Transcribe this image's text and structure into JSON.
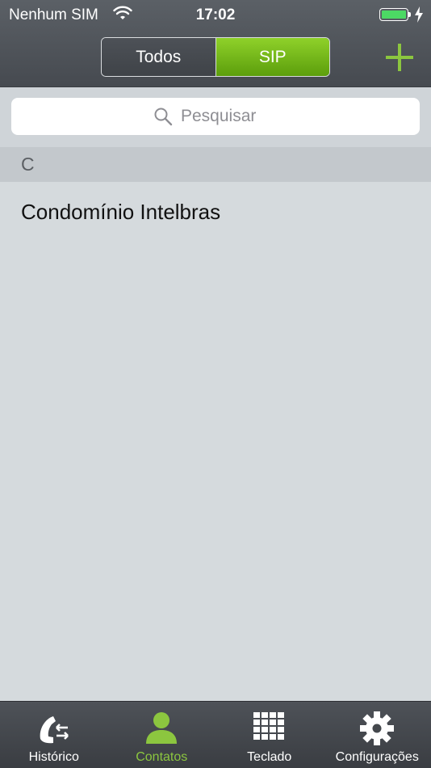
{
  "status_bar": {
    "carrier": "Nenhum SIM",
    "time": "17:02"
  },
  "header": {
    "segments": [
      {
        "label": "Todos",
        "selected": false
      },
      {
        "label": "SIP",
        "selected": true
      }
    ],
    "add_icon": "plus-icon"
  },
  "search": {
    "placeholder": "Pesquisar",
    "value": "",
    "icon": "search-icon"
  },
  "contacts": {
    "sections": [
      {
        "letter": "C",
        "items": [
          "Condomínio Intelbras"
        ]
      }
    ]
  },
  "tabbar": {
    "items": [
      {
        "label": "Histórico",
        "icon": "phone-history-icon",
        "active": false
      },
      {
        "label": "Contatos",
        "icon": "person-icon",
        "active": true
      },
      {
        "label": "Teclado",
        "icon": "keypad-icon",
        "active": false
      },
      {
        "label": "Configurações",
        "icon": "gear-icon",
        "active": false
      }
    ]
  },
  "colors": {
    "accent_green": "#8cc63f",
    "bar_dark": "#464a50",
    "background": "#d5dadd",
    "battery_green": "#4cd964"
  }
}
